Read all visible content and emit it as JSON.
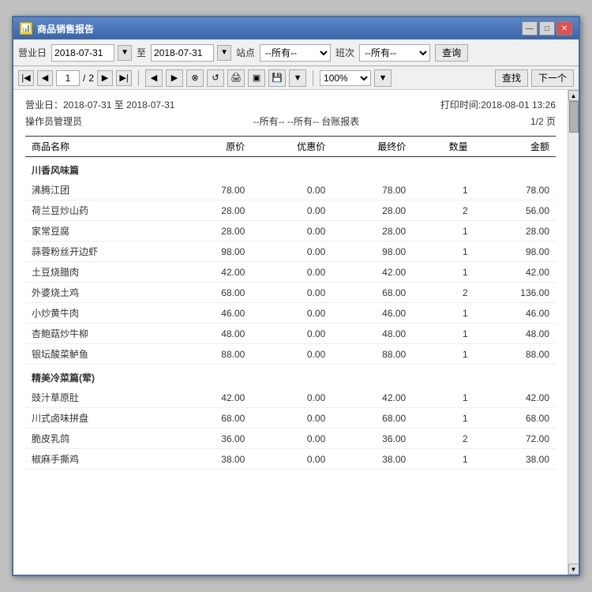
{
  "window": {
    "title": "商品销售报告",
    "controls": [
      "—",
      "□",
      "✕"
    ]
  },
  "toolbar": {
    "date_label": "营业日",
    "date_from": "2018-07-31",
    "date_to": "2018-07-31",
    "to_label": "至",
    "station_label": "站点",
    "station_value": "--所有--",
    "shift_label": "班次",
    "shift_value": "--所有--",
    "query_btn": "查询"
  },
  "nav": {
    "current_page": "1",
    "total_pages": "2",
    "zoom": "100%",
    "search_placeholder": "查找",
    "next_btn": "下一个"
  },
  "report": {
    "date_range_label": "营业日：2018-07-31 至 2018-07-31",
    "print_time": "打印时间:2018-08-01 13:26",
    "operator": "操作员管理员",
    "filter_info": "--所有-- --所有-- 台账报表",
    "page_info": "1/2 页",
    "columns": [
      "商品名称",
      "原价",
      "优惠价",
      "最终价",
      "数量",
      "金额"
    ],
    "categories": [
      {
        "name": "川香风味篇",
        "items": [
          {
            "name": "沸腾江团",
            "price": "78.00",
            "discount": "0.00",
            "final": "78.00",
            "qty": "1",
            "amount": "78.00"
          },
          {
            "name": "荷兰豆炒山药",
            "price": "28.00",
            "discount": "0.00",
            "final": "28.00",
            "qty": "2",
            "amount": "56.00"
          },
          {
            "name": "家常豆腐",
            "price": "28.00",
            "discount": "0.00",
            "final": "28.00",
            "qty": "1",
            "amount": "28.00"
          },
          {
            "name": "蒜蓉粉丝开边虾",
            "price": "98.00",
            "discount": "0.00",
            "final": "98.00",
            "qty": "1",
            "amount": "98.00"
          },
          {
            "name": "土豆烧腊肉",
            "price": "42.00",
            "discount": "0.00",
            "final": "42.00",
            "qty": "1",
            "amount": "42.00"
          },
          {
            "name": "外婆烧土鸡",
            "price": "68.00",
            "discount": "0.00",
            "final": "68.00",
            "qty": "2",
            "amount": "136.00"
          },
          {
            "name": "小炒黄牛肉",
            "price": "46.00",
            "discount": "0.00",
            "final": "46.00",
            "qty": "1",
            "amount": "46.00"
          },
          {
            "name": "杏鲍菇炒牛柳",
            "price": "48.00",
            "discount": "0.00",
            "final": "48.00",
            "qty": "1",
            "amount": "48.00"
          },
          {
            "name": "银坛酸菜鲈鱼",
            "price": "88.00",
            "discount": "0.00",
            "final": "88.00",
            "qty": "1",
            "amount": "88.00"
          }
        ]
      },
      {
        "name": "精美冷菜篇(荤)",
        "items": [
          {
            "name": "豉汁草原肚",
            "price": "42.00",
            "discount": "0.00",
            "final": "42.00",
            "qty": "1",
            "amount": "42.00"
          },
          {
            "name": "川式卤味拼盘",
            "price": "68.00",
            "discount": "0.00",
            "final": "68.00",
            "qty": "1",
            "amount": "68.00"
          },
          {
            "name": "脆皮乳鸽",
            "price": "36.00",
            "discount": "0.00",
            "final": "36.00",
            "qty": "2",
            "amount": "72.00"
          },
          {
            "name": "椒麻手撕鸡",
            "price": "38.00",
            "discount": "0.00",
            "final": "38.00",
            "qty": "1",
            "amount": "38.00"
          }
        ]
      }
    ]
  }
}
